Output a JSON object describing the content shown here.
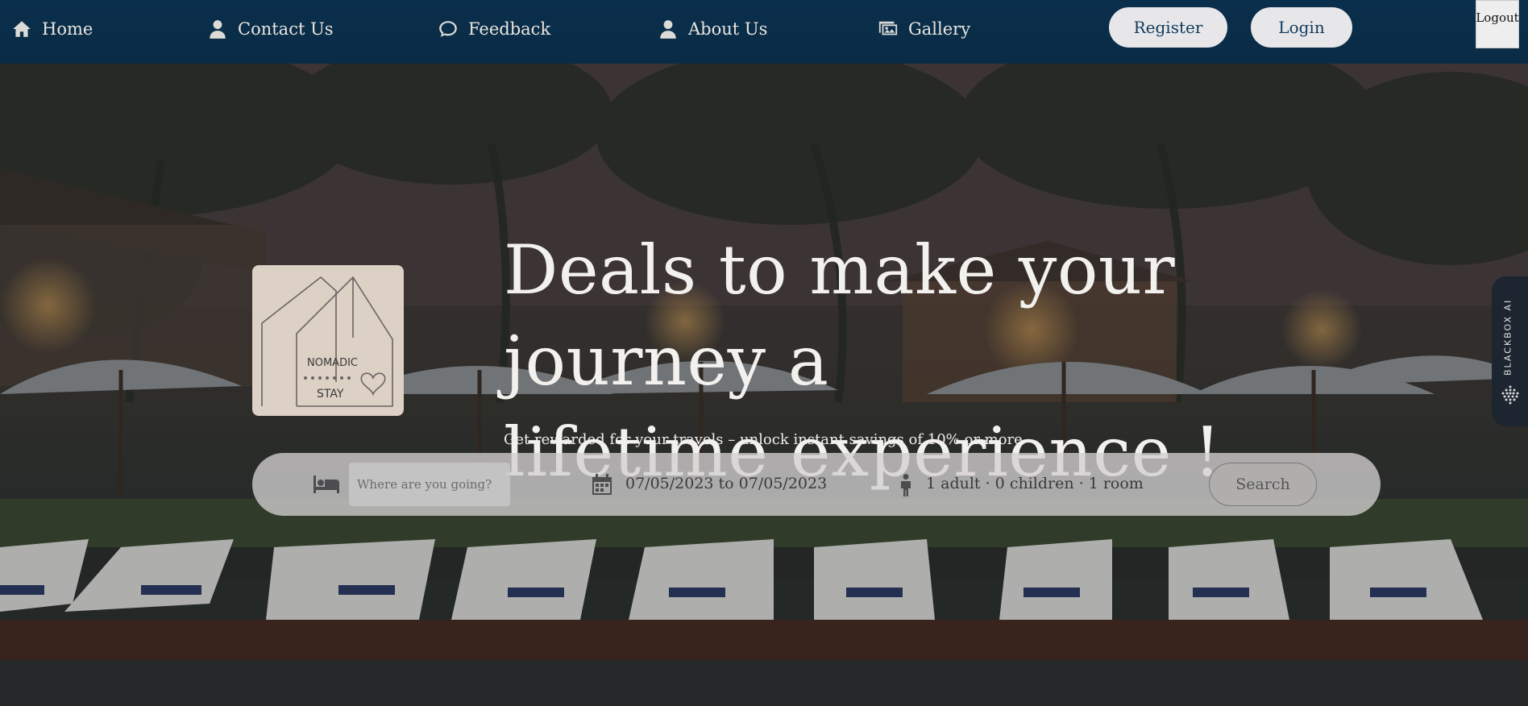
{
  "nav": {
    "items": [
      {
        "label": "Home",
        "icon": "home-icon"
      },
      {
        "label": "Contact Us",
        "icon": "person-icon"
      },
      {
        "label": "Feedback",
        "icon": "chat-bubble-icon"
      },
      {
        "label": "About Us",
        "icon": "person-icon"
      },
      {
        "label": "Gallery",
        "icon": "images-icon"
      }
    ],
    "register_label": "Register",
    "login_label": "Login",
    "logout_label": "Logout"
  },
  "logo": {
    "line1": "NOMADIC",
    "line2": "STAY"
  },
  "hero": {
    "headline_line1": "Deals to make your journey a",
    "headline_line2": "lifetime experience !",
    "subline": "Get rewarded for your travels – unlock instant savings of 10% or more"
  },
  "search": {
    "destination_placeholder": "Where are you going?",
    "dates": "07/05/2023 to 07/05/2023",
    "guests": "1 adult · 0 children · 1 room",
    "button_label": "Search"
  },
  "sidebar_widget": {
    "label": "BLACKBOX AI"
  },
  "colors": {
    "navbar": "#0a2f4c",
    "pill_button": "#e7e7e9",
    "pill_text": "#113a5c",
    "logo_bg": "#ddd1c6"
  }
}
